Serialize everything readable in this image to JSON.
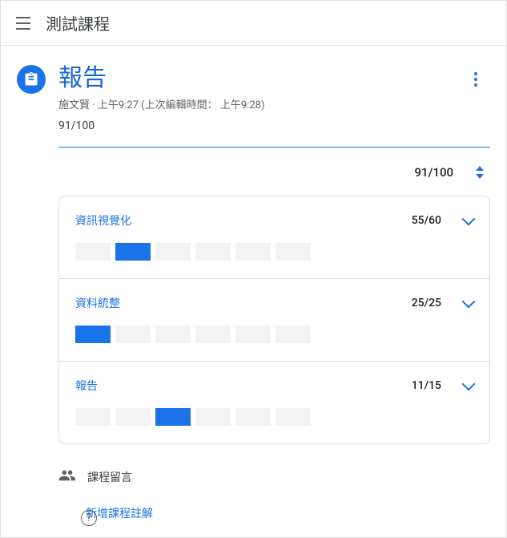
{
  "topbar": {
    "course_title": "測試課程"
  },
  "assignment": {
    "title": "報告",
    "author": "施文賢",
    "posted_time": "上午9:27",
    "edited_label": "上次編輯時間：",
    "edited_time": "上午9:28",
    "score": "91/100"
  },
  "rubric": {
    "total": "91/100",
    "criteria": [
      {
        "title": "資訊視覺化",
        "score": "55/60",
        "blocks": 6,
        "filled_index": 1
      },
      {
        "title": "資料統整",
        "score": "25/25",
        "blocks": 6,
        "filled_index": 0
      },
      {
        "title": "報告",
        "score": "11/15",
        "blocks": 6,
        "filled_index": 2
      }
    ]
  },
  "comments": {
    "section_label": "課程留言",
    "add_label": "新增課程註解"
  }
}
